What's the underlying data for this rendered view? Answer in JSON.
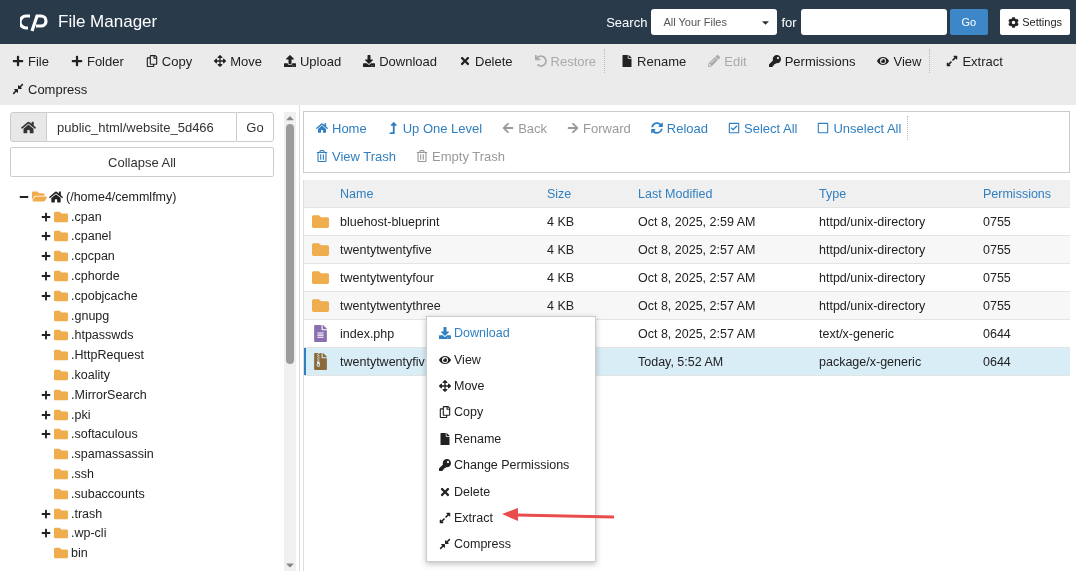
{
  "header": {
    "title": "File Manager",
    "search_label": "Search",
    "scope": "All Your Files",
    "for_label": "for",
    "go": "Go",
    "settings": "Settings"
  },
  "toolbar": [
    {
      "label": "File",
      "disabled": false
    },
    {
      "label": "Folder",
      "disabled": false
    },
    {
      "label": "Copy",
      "disabled": false
    },
    {
      "label": "Move",
      "disabled": false
    },
    {
      "label": "Upload",
      "disabled": false
    },
    {
      "label": "Download",
      "disabled": false
    },
    {
      "label": "Delete",
      "disabled": false
    },
    {
      "label": "Restore",
      "disabled": true
    },
    {
      "label": "Rename",
      "disabled": false
    },
    {
      "label": "Edit",
      "disabled": true
    },
    {
      "label": "Permissions",
      "disabled": false
    },
    {
      "label": "View",
      "disabled": false
    },
    {
      "label": "Extract",
      "disabled": false
    },
    {
      "label": "Compress",
      "disabled": false
    }
  ],
  "path_bar": {
    "value": "public_html/website_5d466",
    "go": "Go"
  },
  "collapse_all": "Collapse All",
  "tree": [
    {
      "label": "(/home4/cemmlfmy)",
      "expanded": true,
      "children": [
        {
          "label": ".cpan",
          "expanded": false
        },
        {
          "label": ".cpanel",
          "expanded": false
        },
        {
          "label": ".cpcpan",
          "expanded": false
        },
        {
          "label": ".cphorde",
          "expanded": false
        },
        {
          "label": ".cpobjcache",
          "expanded": false
        },
        {
          "label": ".gnupg"
        },
        {
          "label": ".htpasswds",
          "expanded": false
        },
        {
          "label": ".HttpRequest"
        },
        {
          "label": ".koality"
        },
        {
          "label": ".MirrorSearch",
          "expanded": false
        },
        {
          "label": ".pki",
          "expanded": false
        },
        {
          "label": ".softaculous",
          "expanded": false
        },
        {
          "label": ".spamassassin"
        },
        {
          "label": ".ssh"
        },
        {
          "label": ".subaccounts"
        },
        {
          "label": ".trash",
          "expanded": false
        },
        {
          "label": ".wp-cli",
          "expanded": false
        },
        {
          "label": "bin"
        }
      ]
    }
  ],
  "nav": [
    {
      "label": "Home",
      "disabled": false
    },
    {
      "label": "Up One Level",
      "disabled": false
    },
    {
      "label": "Back",
      "disabled": true
    },
    {
      "label": "Forward",
      "disabled": true
    },
    {
      "label": "Reload",
      "disabled": false
    },
    {
      "label": "Select All",
      "disabled": false
    },
    {
      "label": "Unselect All",
      "disabled": false
    },
    {
      "label": "View Trash",
      "disabled": false
    },
    {
      "label": "Empty Trash",
      "disabled": true
    }
  ],
  "table": {
    "columns": [
      "Name",
      "Size",
      "Last Modified",
      "Type",
      "Permissions"
    ],
    "rows": [
      {
        "kind": "folder",
        "name": "bluehost-blueprint",
        "size": "4 KB",
        "modified": "Oct 8, 2025, 2:59 AM",
        "type": "httpd/unix-directory",
        "permissions": "0755",
        "selected": false
      },
      {
        "kind": "folder",
        "name": "twentytwentyfive",
        "size": "4 KB",
        "modified": "Oct 8, 2025, 2:57 AM",
        "type": "httpd/unix-directory",
        "permissions": "0755",
        "selected": false
      },
      {
        "kind": "folder",
        "name": "twentytwentyfour",
        "size": "4 KB",
        "modified": "Oct 8, 2025, 2:57 AM",
        "type": "httpd/unix-directory",
        "permissions": "0755",
        "selected": false
      },
      {
        "kind": "folder",
        "name": "twentytwentythree",
        "size": "4 KB",
        "modified": "Oct 8, 2025, 2:57 AM",
        "type": "httpd/unix-directory",
        "permissions": "0755",
        "selected": false
      },
      {
        "kind": "text",
        "name": "index.php",
        "modified": "Oct 8, 2025, 2:57 AM",
        "type": "text/x-generic",
        "permissions": "0644",
        "selected": false
      },
      {
        "kind": "archive",
        "name": "twentytwentyfiv",
        "modified": "Today, 5:52 AM",
        "type": "package/x-generic",
        "permissions": "0644",
        "selected": true
      }
    ]
  },
  "context_menu": [
    {
      "label": "Download",
      "selected": true
    },
    {
      "label": "View",
      "selected": false
    },
    {
      "label": "Move",
      "selected": false
    },
    {
      "label": "Copy",
      "selected": false
    },
    {
      "label": "Rename",
      "selected": false
    },
    {
      "label": "Change Permissions",
      "selected": false
    },
    {
      "label": "Delete",
      "selected": false
    },
    {
      "label": "Extract",
      "selected": false
    },
    {
      "label": "Compress",
      "selected": false
    }
  ]
}
